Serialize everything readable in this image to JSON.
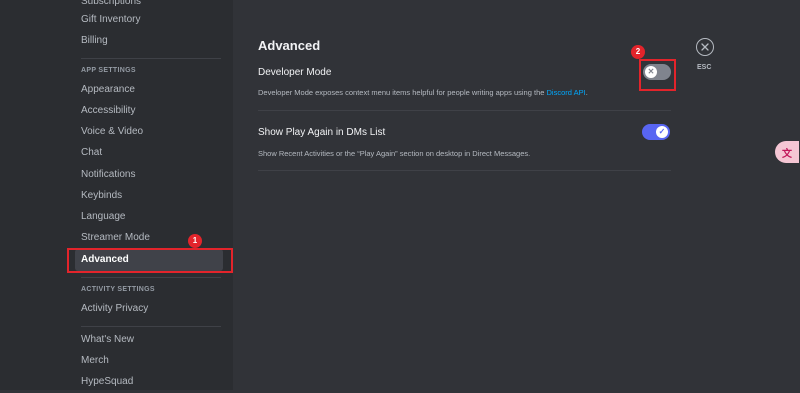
{
  "sidebar": {
    "top_items": [
      {
        "label": "Subscriptions"
      },
      {
        "label": "Gift Inventory"
      },
      {
        "label": "Billing"
      }
    ],
    "app_settings_header": "APP SETTINGS",
    "app_items": [
      {
        "label": "Appearance"
      },
      {
        "label": "Accessibility"
      },
      {
        "label": "Voice & Video"
      },
      {
        "label": "Chat"
      },
      {
        "label": "Notifications"
      },
      {
        "label": "Keybinds"
      },
      {
        "label": "Language"
      },
      {
        "label": "Streamer Mode"
      },
      {
        "label": "Advanced"
      }
    ],
    "activity_settings_header": "ACTIVITY SETTINGS",
    "activity_items": [
      {
        "label": "Activity Privacy"
      }
    ],
    "bottom_items": [
      {
        "label": "What's New"
      },
      {
        "label": "Merch"
      },
      {
        "label": "HypeSquad"
      }
    ]
  },
  "main": {
    "title": "Advanced",
    "settings": [
      {
        "label": "Developer Mode",
        "description": "Developer Mode exposes context menu items helpful for people writing apps using the ",
        "link": "Discord API",
        "description_end": ".",
        "enabled": false
      },
      {
        "label": "Show Play Again in DMs List",
        "description": "Show Recent Activities or the “Play Again” section on desktop in Direct Messages.",
        "enabled": true
      }
    ]
  },
  "close": {
    "label": "ESC"
  },
  "annotations": [
    {
      "number": "1",
      "color": "#e3242b"
    },
    {
      "number": "2",
      "color": "#e3242b"
    }
  ],
  "colors": {
    "accent": "#5865f2",
    "toggle_off": "#80848e",
    "link": "#00a8fc"
  }
}
